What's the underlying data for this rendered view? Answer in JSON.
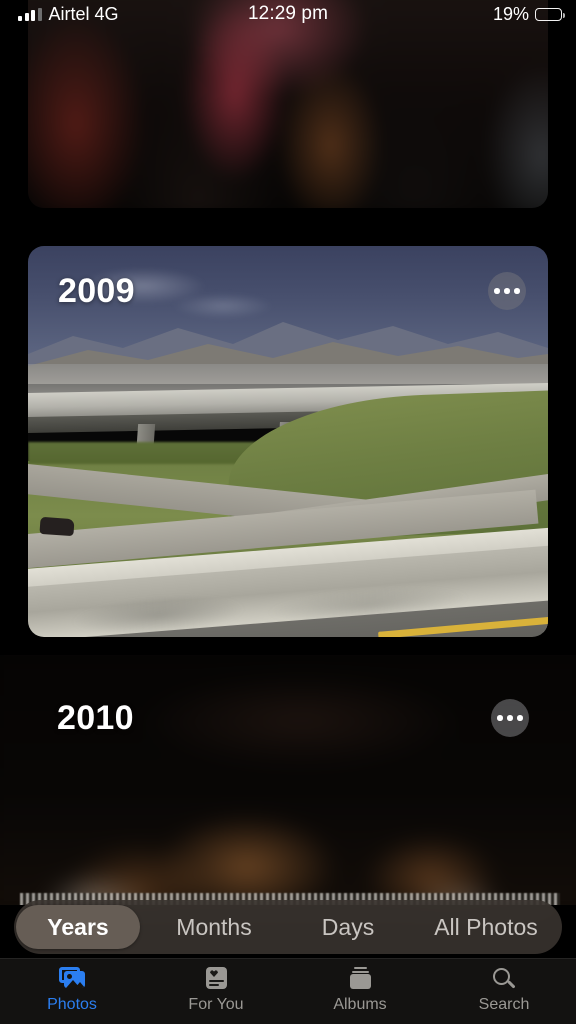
{
  "status_bar": {
    "carrier": "Airtel 4G",
    "signal_icon": "signal-bars-icon",
    "time": "12:29 pm",
    "battery_percent": "19%",
    "battery_icon": "battery-low-icon",
    "battery_fill_color": "#f3cd2e",
    "battery_level": 19
  },
  "app": {
    "name": "Photos",
    "screen": "Years"
  },
  "cards": [
    {
      "id": "card-top",
      "year_label": "",
      "more_icon": "ellipsis-icon",
      "description": "blurred dark crowd photo, partially scrolled off top"
    },
    {
      "id": "card-2009",
      "year_label": "2009",
      "more_icon": "ellipsis-icon",
      "description": "highway overpass with mountains and green hills"
    },
    {
      "id": "card-2010",
      "year_label": "2010",
      "more_icon": "ellipsis-icon",
      "description": "very dark blurred photo with warm tones"
    }
  ],
  "segmented_control": {
    "selected": "Years",
    "options": [
      {
        "label": "Years",
        "selected": true
      },
      {
        "label": "Months",
        "selected": false
      },
      {
        "label": "Days",
        "selected": false
      },
      {
        "label": "All Photos",
        "selected": false
      }
    ]
  },
  "tab_bar": {
    "active": "Photos",
    "active_color": "#2b7ef0",
    "inactive_color": "#9a9894",
    "items": [
      {
        "label": "Photos",
        "icon": "photos-icon",
        "active": true
      },
      {
        "label": "For You",
        "icon": "for-you-icon",
        "active": false
      },
      {
        "label": "Albums",
        "icon": "albums-icon",
        "active": false
      },
      {
        "label": "Search",
        "icon": "search-icon",
        "active": false
      }
    ]
  }
}
